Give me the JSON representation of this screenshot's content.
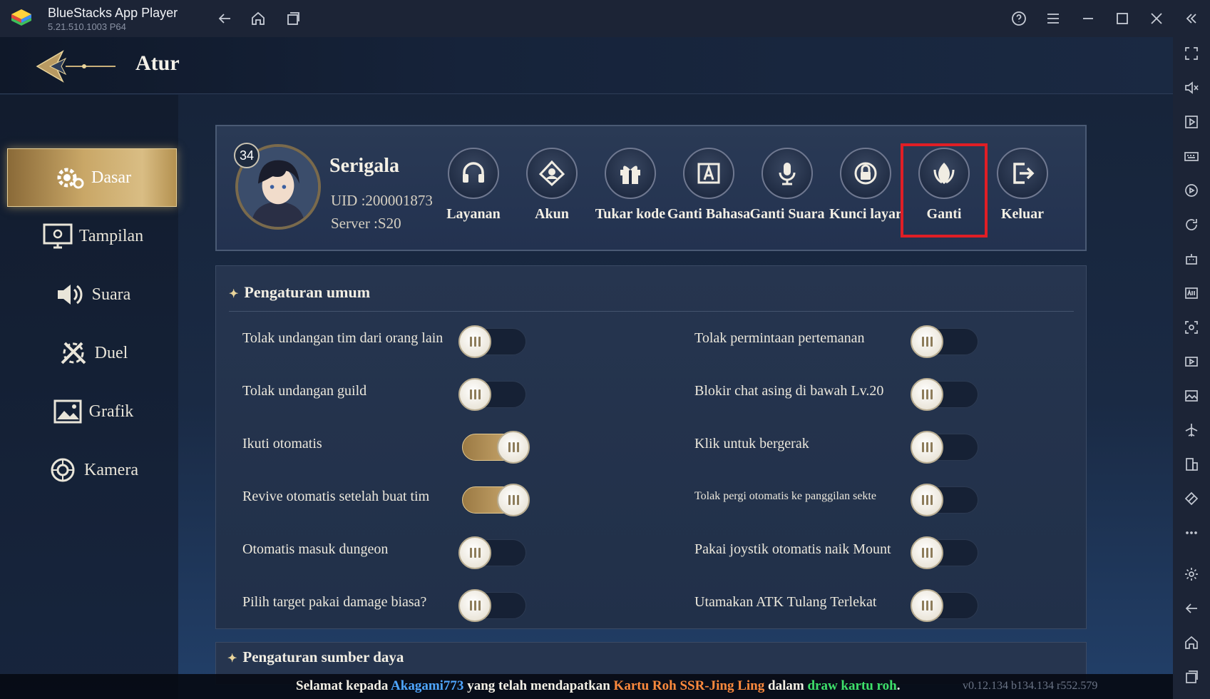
{
  "window": {
    "app_title": "BlueStacks App Player",
    "app_version": "5.21.510.1003  P64",
    "titlebar_icons": [
      "back-icon",
      "home-icon",
      "recent-apps-icon",
      "help-icon",
      "menu-icon",
      "minimize-icon",
      "maximize-icon",
      "close-icon",
      "collapse-sidebar-icon"
    ]
  },
  "bs_sidebar": {
    "icons": [
      "fullscreen-icon",
      "volume-icon",
      "play-video-icon",
      "keyboard-icon",
      "macro-icon",
      "rotate-icon",
      "robot-icon",
      "apk-icon",
      "screenshot-icon",
      "record-icon",
      "media-folder-icon",
      "airplane-icon",
      "multi-instance-icon",
      "eco-mode-icon",
      "more-icon",
      "settings-icon",
      "back-icon",
      "home-icon",
      "recent-apps-icon"
    ]
  },
  "game": {
    "header_title": "Atur",
    "nav": [
      {
        "label": "Dasar",
        "icon": "gear-icon",
        "active": true
      },
      {
        "label": "Tampilan",
        "icon": "monitor-icon",
        "active": false
      },
      {
        "label": "Suara",
        "icon": "speaker-icon",
        "active": false
      },
      {
        "label": "Duel",
        "icon": "swords-icon",
        "active": false
      },
      {
        "label": "Grafik",
        "icon": "image-icon",
        "active": false
      },
      {
        "label": "Kamera",
        "icon": "camera-icon",
        "active": false
      }
    ],
    "profile": {
      "level": "34",
      "name": "Serigala",
      "uid": "UID :200001873",
      "server": "Server :S20"
    },
    "actions": [
      {
        "label": "Layanan",
        "icon": "headset-icon"
      },
      {
        "label": "Akun",
        "icon": "account-icon"
      },
      {
        "label": "Tukar kode",
        "icon": "gift-icon"
      },
      {
        "label": "Ganti Bahasa",
        "icon": "language-icon"
      },
      {
        "label": "Ganti Suara",
        "icon": "voice-icon"
      },
      {
        "label": "Kunci layar",
        "icon": "lock-icon"
      },
      {
        "label": "Ganti",
        "icon": "switch-character-icon",
        "highlighted": true
      },
      {
        "label": "Keluar",
        "icon": "logout-icon"
      }
    ],
    "general_settings": {
      "title": "Pengaturan umum",
      "left": [
        {
          "label": "Tolak undangan tim dari orang lain",
          "on": false
        },
        {
          "label": "Tolak undangan guild",
          "on": false
        },
        {
          "label": "Ikuti otomatis",
          "on": true
        },
        {
          "label": "Revive otomatis setelah buat tim",
          "on": true
        },
        {
          "label": "Otomatis masuk dungeon",
          "on": false
        },
        {
          "label": "Pilih target pakai damage biasa?",
          "on": false
        }
      ],
      "right": [
        {
          "label": "Tolak permintaan pertemanan",
          "on": false
        },
        {
          "label": "Blokir chat asing di bawah Lv.20",
          "on": false
        },
        {
          "label": "Klik untuk bergerak",
          "on": false
        },
        {
          "label": "Tolak pergi otomatis ke panggilan sekte",
          "on": false
        },
        {
          "label": "Pakai joystik otomatis naik Mount",
          "on": false
        },
        {
          "label": "Utamakan ATK Tulang Terlekat",
          "on": false
        }
      ]
    },
    "next_section_title": "Pengaturan sumber daya",
    "broadcast": {
      "prefix": "Selamat kepada ",
      "player": "Akagami773",
      "middle": " yang telah mendapatkan ",
      "item": "Kartu Roh SSR-Jing Ling",
      "middle2": " dalam ",
      "source": "draw kartu roh",
      "suffix": "."
    },
    "version": "v0.12.134 b134.134 r552.579"
  },
  "colors": {
    "highlight_box": "#e01e25",
    "toggle_on": "#d4b277",
    "player_name": "#4fa6ff",
    "item_name": "#ff8a3d",
    "draw_source": "#3ee06a"
  }
}
